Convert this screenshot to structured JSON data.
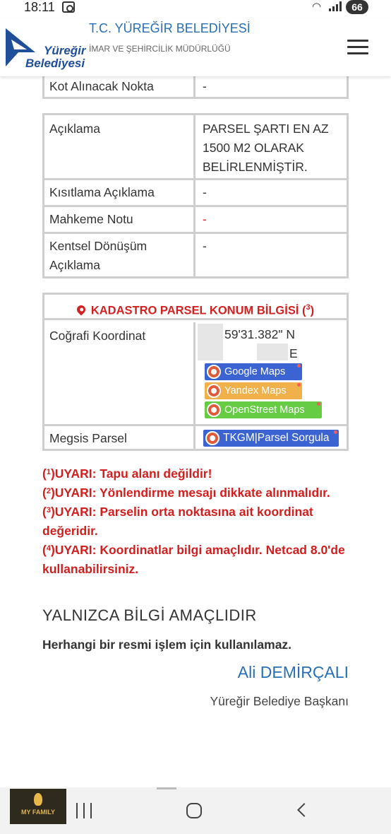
{
  "status_bar": {
    "time": "18:11",
    "battery": "66",
    "wifi_icon": "wifi-icon",
    "signal_icon": "signal-icon"
  },
  "header": {
    "logo_line1": "Yüreğir",
    "logo_line2": "Belediyesi",
    "title": "T.C. YÜREĞİR BELEDİYESİ",
    "subtitle": "İMAR VE ŞEHİRCİLİK MÜDÜRLÜĞÜ",
    "menu_icon": "hamburger-menu-icon"
  },
  "table_top": {
    "rows": [
      {
        "label": "Kot Alınacak Nokta",
        "value": "-"
      }
    ]
  },
  "table_desc": {
    "rows": [
      {
        "label": "Açıklama",
        "value": "PARSEL ŞARTI EN AZ 1500 M2 OLARAK BELİRLENMİŞTİR."
      },
      {
        "label": "Kısıtlama Açıklama",
        "value": "-"
      },
      {
        "label": "Mahkeme Notu",
        "value": "-"
      },
      {
        "label": "Kentsel Dönüşüm Açıklama",
        "value": "-"
      }
    ]
  },
  "kadastro": {
    "heading": "KADASTRO PARSEL KONUM BİLGİSİ",
    "heading_note": "3",
    "coord_label": "Coğrafi Koordinat",
    "coord_line1": "59'31.382\" N",
    "coord_line2": "E",
    "map_buttons": [
      {
        "label": "Google Maps",
        "color": "#3b63d1"
      },
      {
        "label": "Yandex Maps",
        "color": "#f0b04a"
      },
      {
        "label": "OpenStreet Maps",
        "color": "#66cc44"
      }
    ],
    "megsis_label": "Megsis Parsel",
    "megsis_button": {
      "label": "TKGM|Parsel Sorgula",
      "color": "#3b63d1"
    }
  },
  "warnings": [
    {
      "num": "1",
      "text": "UYARI: Tapu alanı değildir!"
    },
    {
      "num": "2",
      "text": "UYARI: Yönlendirme mesajı dikkate alınmalıdır."
    },
    {
      "num": "3",
      "text": "UYARI: Parselin orta noktasına ait koordinat değeridir."
    },
    {
      "num": "4",
      "text": "UYARI: Koordinatlar bilgi amaçlıdır. Netcad 8.0'de kullanabilirsiniz."
    }
  ],
  "info": {
    "title": "YALNIZCA BİLGİ AMAÇLIDIR",
    "subtitle": "Herhangi bir resmi işlem için kullanılamaz."
  },
  "signature": {
    "name": "Ali DEMİRÇALI",
    "role": "Yüreğir Belediye Başkanı"
  },
  "thumbnail": {
    "text": "MY FAMILY"
  },
  "nav": {
    "recent_icon": "recent-apps-icon",
    "home_icon": "home-icon",
    "back_icon": "back-icon"
  }
}
